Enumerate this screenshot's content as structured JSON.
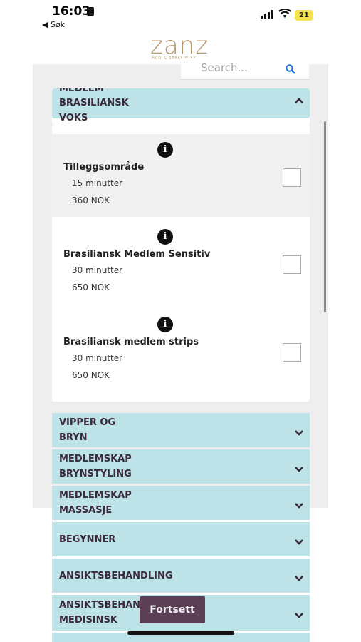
{
  "status": {
    "time": "16:03",
    "back": "◀ Søk",
    "battery": "21"
  },
  "brand": {
    "logo": "zanz",
    "tagline": "HUD & SPAKLINIKK"
  },
  "search": {
    "placeholder": "Search..."
  },
  "open_category": {
    "line1": "MEDLEM",
    "line2": "BRASILIANSK",
    "line3": "VOKS"
  },
  "services": [
    {
      "name": "Tilleggsområde",
      "duration": "15 minutter",
      "price": "360 NOK"
    },
    {
      "name": "Brasiliansk Medlem Sensitiv",
      "duration": "30 minutter",
      "price": "650 NOK"
    },
    {
      "name": "Brasiliansk medlem strips",
      "duration": "30 minutter",
      "price": "650 NOK"
    }
  ],
  "categories": [
    {
      "line1": "VIPPER OG",
      "line2": "BRYN"
    },
    {
      "line1": "MEDLEMSKAP",
      "line2": "BRYNSTYLING"
    },
    {
      "line1": "MEDLEMSKAP",
      "line2": "MASSASJE"
    },
    {
      "line1": "BEGYNNER",
      "line2": ""
    },
    {
      "line1": "ANSIKTSBEHANDLING",
      "line2": ""
    },
    {
      "line1": "ANSIKTSBEHANDLING",
      "line2": "MEDISINSK"
    }
  ],
  "actions": {
    "continue": "Fortsett"
  },
  "colors": {
    "accent_bg": "#bde3e8",
    "label": "#3a2a3a",
    "brand": "#b59770",
    "button": "#5a3f55"
  }
}
